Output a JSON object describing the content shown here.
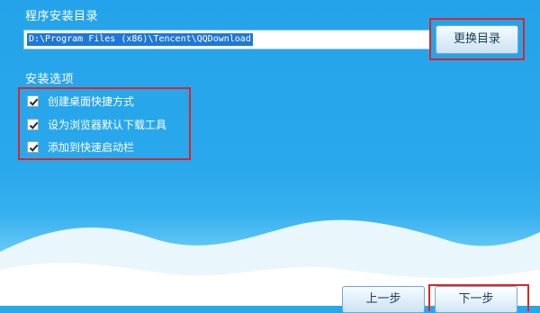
{
  "install_dir": {
    "section_title": "程序安装目录",
    "path": "D:\\Program Files (x86)\\Tencent\\QQDownload",
    "change_button": "更换目录"
  },
  "install_options": {
    "section_title": "安装选项",
    "items": [
      {
        "label": "创建桌面快捷方式",
        "checked": true
      },
      {
        "label": "设为浏览器默认下载工具",
        "checked": true
      },
      {
        "label": "添加到快速启动栏",
        "checked": true
      }
    ]
  },
  "footer": {
    "back_button": "上一步",
    "next_button": "下一步"
  },
  "colors": {
    "background": "#2aa6ea",
    "highlight_border": "#d9252b"
  }
}
